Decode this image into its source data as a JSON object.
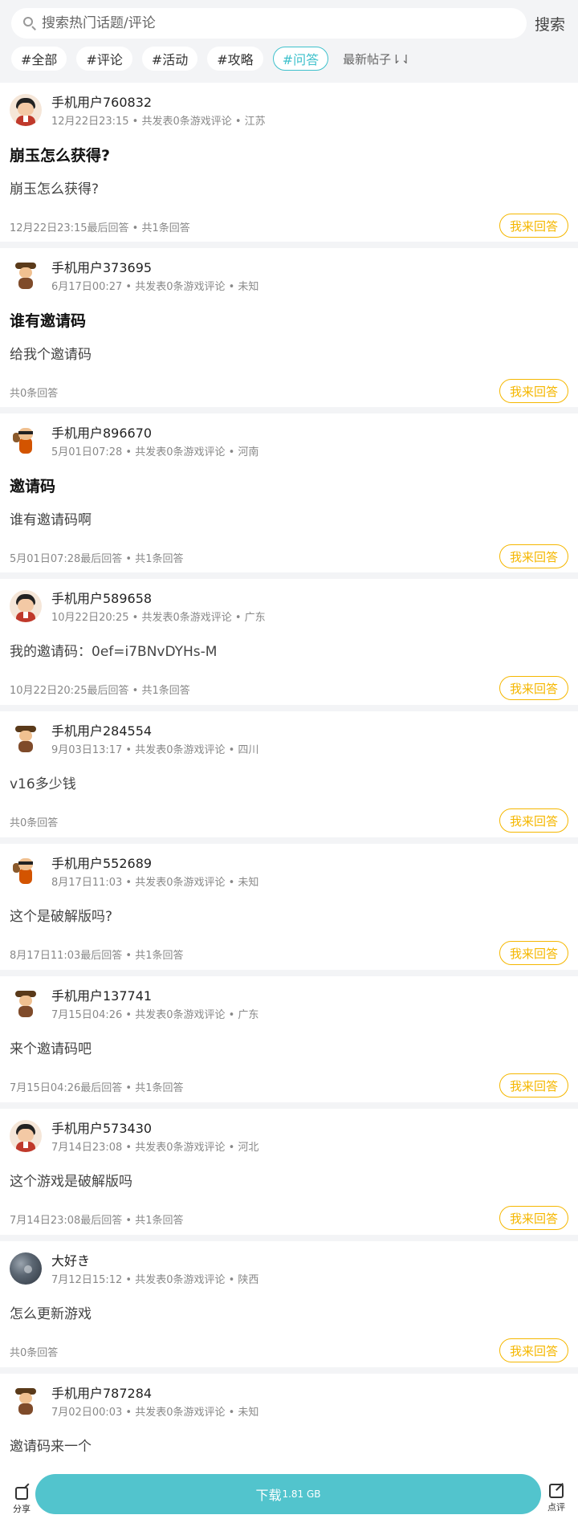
{
  "search": {
    "placeholder": "搜索热门话题/评论",
    "button": "搜索"
  },
  "tags": [
    {
      "label": "#全部",
      "active": false
    },
    {
      "label": "#评论",
      "active": false
    },
    {
      "label": "#活动",
      "active": false
    },
    {
      "label": "#攻略",
      "active": false
    },
    {
      "label": "#问答",
      "active": true
    }
  ],
  "sort_label": "最新帖子⇂⇃",
  "answer_button_label": "我来回答",
  "posts": [
    {
      "avatar": "boy-avatar",
      "user": "手机用户760832",
      "meta": "12月22日23:15 • 共发表0条游戏评论 • 江苏",
      "title": "崩玉怎么获得?",
      "content": "崩玉怎么获得?",
      "footer": "12月22日23:15最后回答 • 共1条回答"
    },
    {
      "avatar": "cowboy-avatar",
      "user": "手机用户373695",
      "meta": "6月17日00:27 • 共发表0条游戏评论 • 未知",
      "title": "谁有邀请码",
      "content": "给我个邀请码",
      "footer": "共0条回答"
    },
    {
      "avatar": "thief-avatar",
      "user": "手机用户896670",
      "meta": "5月01日07:28 • 共发表0条游戏评论 • 河南",
      "title": "邀请码",
      "content": "谁有邀请码啊",
      "footer": "5月01日07:28最后回答 • 共1条回答"
    },
    {
      "avatar": "boy-avatar",
      "user": "手机用户589658",
      "meta": "10月22日20:25 • 共发表0条游戏评论 • 广东",
      "title": "",
      "content": "我的邀请码：0ef=i7BNvDYHs-M",
      "footer": "10月22日20:25最后回答 • 共1条回答"
    },
    {
      "avatar": "cowboy-avatar",
      "user": "手机用户284554",
      "meta": "9月03日13:17 • 共发表0条游戏评论 • 四川",
      "title": "",
      "content": "v16多少钱",
      "footer": "共0条回答"
    },
    {
      "avatar": "thief-avatar",
      "user": "手机用户552689",
      "meta": "8月17日11:03 • 共发表0条游戏评论 • 未知",
      "title": "",
      "content": "这个是破解版吗?",
      "footer": "8月17日11:03最后回答 • 共1条回答"
    },
    {
      "avatar": "cowboy-avatar",
      "user": "手机用户137741",
      "meta": "7月15日04:26 • 共发表0条游戏评论 • 广东",
      "title": "",
      "content": "来个邀请码吧",
      "footer": "7月15日04:26最后回答 • 共1条回答"
    },
    {
      "avatar": "boy-avatar",
      "user": "手机用户573430",
      "meta": "7月14日23:08 • 共发表0条游戏评论 • 河北",
      "title": "",
      "content": "这个游戏是破解版吗",
      "footer": "7月14日23:08最后回答 • 共1条回答"
    },
    {
      "avatar": "photo-avatar",
      "user": "大好き",
      "meta": "7月12日15:12 • 共发表0条游戏评论 • 陕西",
      "title": "",
      "content": "怎么更新游戏",
      "footer": "共0条回答"
    },
    {
      "avatar": "cowboy-avatar",
      "user": "手机用户787284",
      "meta": "7月02日00:03 • 共发表0条游戏评论 • 未知",
      "title": "",
      "content": "邀请码来一个",
      "footer": ""
    }
  ],
  "bottom": {
    "share": "分享",
    "review": "点评",
    "download": "下载",
    "size": "1.81 GB"
  }
}
